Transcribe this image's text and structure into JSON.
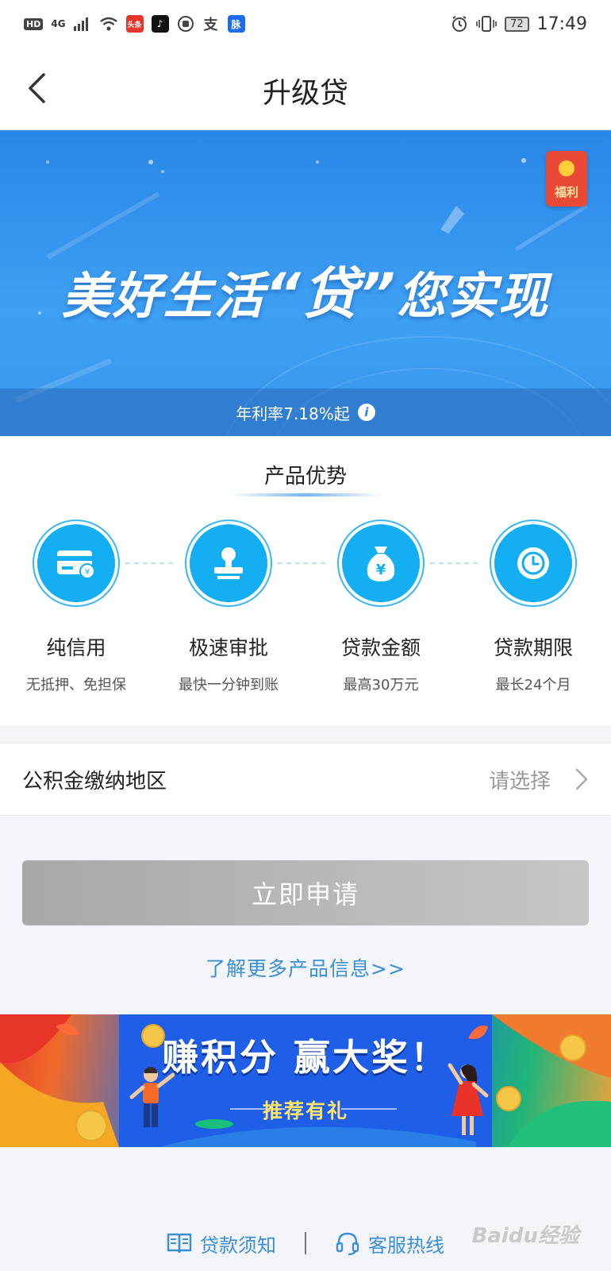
{
  "status_bar": {
    "left_badges": [
      "HD",
      "4G"
    ],
    "app_icons": [
      "头条",
      "♪",
      "支",
      "脉"
    ],
    "battery": "72",
    "time": "17:49"
  },
  "header": {
    "title": "升级贷"
  },
  "hero": {
    "badge_label": "福利",
    "slogan_part1": "美好生活",
    "slogan_quote": "“贷”",
    "slogan_part2": "您实现",
    "rate_text": "年利率7.18%起",
    "info_icon": "i"
  },
  "advantages": {
    "title": "产品优势",
    "items": [
      {
        "name": "纯信用",
        "desc": "无抵押、免担保",
        "icon": "card-icon"
      },
      {
        "name": "极速审批",
        "desc": "最快一分钟到账",
        "icon": "stamp-icon"
      },
      {
        "name": "贷款金额",
        "desc": "最高30万元",
        "icon": "money-bag-icon"
      },
      {
        "name": "贷款期限",
        "desc": "最长24个月",
        "icon": "clock-icon"
      }
    ]
  },
  "region": {
    "label": "公积金缴纳地区",
    "placeholder": "请选择"
  },
  "apply": {
    "label": "立即申请"
  },
  "more_link": "了解更多产品信息>>",
  "promo": {
    "title": "赚积分 赢大奖！",
    "subtitle": "推荐有礼"
  },
  "footer": {
    "notice_label": "贷款须知",
    "hotline_label": "客服热线"
  },
  "watermark": "Baidu经验",
  "colors": {
    "primary_blue": "#2a86e8",
    "icon_blue": "#14aef2",
    "link_blue": "#3b8fd8",
    "disabled_gray": "#b5b5b5"
  }
}
